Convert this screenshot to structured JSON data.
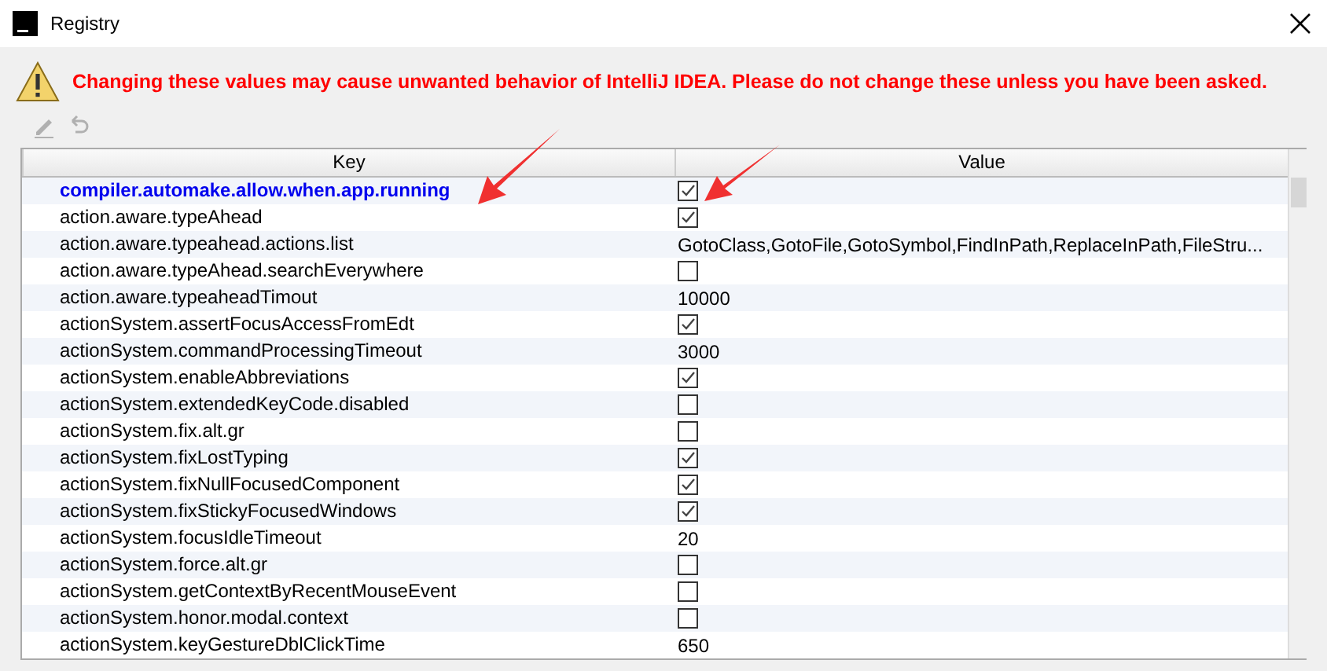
{
  "window": {
    "title": "Registry"
  },
  "warning": "Changing these values may cause unwanted behavior of IntelliJ IDEA. Please do not change these unless you have been asked.",
  "toolbar": [
    {
      "kind": "edit",
      "disabled": true
    },
    {
      "kind": "revert",
      "disabled": true
    }
  ],
  "table": {
    "columns": [
      "Key",
      "Value"
    ],
    "rows": [
      {
        "key": "compiler.automake.allow.when.app.running",
        "modified": true,
        "kind": "checkbox",
        "checked": true
      },
      {
        "key": "action.aware.typeAhead",
        "modified": false,
        "kind": "checkbox",
        "checked": true
      },
      {
        "key": "action.aware.typeahead.actions.list",
        "modified": false,
        "kind": "text",
        "value": "GotoClass,GotoFile,GotoSymbol,FindInPath,ReplaceInPath,FileStru..."
      },
      {
        "key": "action.aware.typeAhead.searchEverywhere",
        "modified": false,
        "kind": "checkbox",
        "checked": false
      },
      {
        "key": "action.aware.typeaheadTimout",
        "modified": false,
        "kind": "text",
        "value": "10000"
      },
      {
        "key": "actionSystem.assertFocusAccessFromEdt",
        "modified": false,
        "kind": "checkbox",
        "checked": true
      },
      {
        "key": "actionSystem.commandProcessingTimeout",
        "modified": false,
        "kind": "text",
        "value": "3000"
      },
      {
        "key": "actionSystem.enableAbbreviations",
        "modified": false,
        "kind": "checkbox",
        "checked": true
      },
      {
        "key": "actionSystem.extendedKeyCode.disabled",
        "modified": false,
        "kind": "checkbox",
        "checked": false
      },
      {
        "key": "actionSystem.fix.alt.gr",
        "modified": false,
        "kind": "checkbox",
        "checked": false
      },
      {
        "key": "actionSystem.fixLostTyping",
        "modified": false,
        "kind": "checkbox",
        "checked": true
      },
      {
        "key": "actionSystem.fixNullFocusedComponent",
        "modified": false,
        "kind": "checkbox",
        "checked": true
      },
      {
        "key": "actionSystem.fixStickyFocusedWindows",
        "modified": false,
        "kind": "checkbox",
        "checked": true
      },
      {
        "key": "actionSystem.focusIdleTimeout",
        "modified": false,
        "kind": "text",
        "value": "20"
      },
      {
        "key": "actionSystem.force.alt.gr",
        "modified": false,
        "kind": "checkbox",
        "checked": false
      },
      {
        "key": "actionSystem.getContextByRecentMouseEvent",
        "modified": false,
        "kind": "checkbox",
        "checked": false
      },
      {
        "key": "actionSystem.honor.modal.context",
        "modified": false,
        "kind": "checkbox",
        "checked": false
      },
      {
        "key": "actionSystem.keyGestureDblClickTime",
        "modified": false,
        "kind": "text",
        "value": "650"
      }
    ]
  }
}
